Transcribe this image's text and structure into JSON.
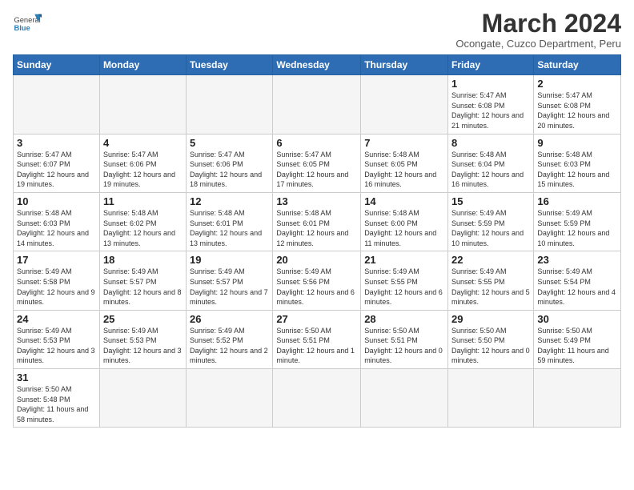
{
  "header": {
    "logo_general": "General",
    "logo_blue": "Blue",
    "month_title": "March 2024",
    "subtitle": "Ocongate, Cuzco Department, Peru"
  },
  "weekdays": [
    "Sunday",
    "Monday",
    "Tuesday",
    "Wednesday",
    "Thursday",
    "Friday",
    "Saturday"
  ],
  "weeks": [
    [
      {
        "day": "",
        "info": ""
      },
      {
        "day": "",
        "info": ""
      },
      {
        "day": "",
        "info": ""
      },
      {
        "day": "",
        "info": ""
      },
      {
        "day": "",
        "info": ""
      },
      {
        "day": "1",
        "info": "Sunrise: 5:47 AM\nSunset: 6:08 PM\nDaylight: 12 hours and 21 minutes."
      },
      {
        "day": "2",
        "info": "Sunrise: 5:47 AM\nSunset: 6:08 PM\nDaylight: 12 hours and 20 minutes."
      }
    ],
    [
      {
        "day": "3",
        "info": "Sunrise: 5:47 AM\nSunset: 6:07 PM\nDaylight: 12 hours and 19 minutes."
      },
      {
        "day": "4",
        "info": "Sunrise: 5:47 AM\nSunset: 6:06 PM\nDaylight: 12 hours and 19 minutes."
      },
      {
        "day": "5",
        "info": "Sunrise: 5:47 AM\nSunset: 6:06 PM\nDaylight: 12 hours and 18 minutes."
      },
      {
        "day": "6",
        "info": "Sunrise: 5:47 AM\nSunset: 6:05 PM\nDaylight: 12 hours and 17 minutes."
      },
      {
        "day": "7",
        "info": "Sunrise: 5:48 AM\nSunset: 6:05 PM\nDaylight: 12 hours and 16 minutes."
      },
      {
        "day": "8",
        "info": "Sunrise: 5:48 AM\nSunset: 6:04 PM\nDaylight: 12 hours and 16 minutes."
      },
      {
        "day": "9",
        "info": "Sunrise: 5:48 AM\nSunset: 6:03 PM\nDaylight: 12 hours and 15 minutes."
      }
    ],
    [
      {
        "day": "10",
        "info": "Sunrise: 5:48 AM\nSunset: 6:03 PM\nDaylight: 12 hours and 14 minutes."
      },
      {
        "day": "11",
        "info": "Sunrise: 5:48 AM\nSunset: 6:02 PM\nDaylight: 12 hours and 13 minutes."
      },
      {
        "day": "12",
        "info": "Sunrise: 5:48 AM\nSunset: 6:01 PM\nDaylight: 12 hours and 13 minutes."
      },
      {
        "day": "13",
        "info": "Sunrise: 5:48 AM\nSunset: 6:01 PM\nDaylight: 12 hours and 12 minutes."
      },
      {
        "day": "14",
        "info": "Sunrise: 5:48 AM\nSunset: 6:00 PM\nDaylight: 12 hours and 11 minutes."
      },
      {
        "day": "15",
        "info": "Sunrise: 5:49 AM\nSunset: 5:59 PM\nDaylight: 12 hours and 10 minutes."
      },
      {
        "day": "16",
        "info": "Sunrise: 5:49 AM\nSunset: 5:59 PM\nDaylight: 12 hours and 10 minutes."
      }
    ],
    [
      {
        "day": "17",
        "info": "Sunrise: 5:49 AM\nSunset: 5:58 PM\nDaylight: 12 hours and 9 minutes."
      },
      {
        "day": "18",
        "info": "Sunrise: 5:49 AM\nSunset: 5:57 PM\nDaylight: 12 hours and 8 minutes."
      },
      {
        "day": "19",
        "info": "Sunrise: 5:49 AM\nSunset: 5:57 PM\nDaylight: 12 hours and 7 minutes."
      },
      {
        "day": "20",
        "info": "Sunrise: 5:49 AM\nSunset: 5:56 PM\nDaylight: 12 hours and 6 minutes."
      },
      {
        "day": "21",
        "info": "Sunrise: 5:49 AM\nSunset: 5:55 PM\nDaylight: 12 hours and 6 minutes."
      },
      {
        "day": "22",
        "info": "Sunrise: 5:49 AM\nSunset: 5:55 PM\nDaylight: 12 hours and 5 minutes."
      },
      {
        "day": "23",
        "info": "Sunrise: 5:49 AM\nSunset: 5:54 PM\nDaylight: 12 hours and 4 minutes."
      }
    ],
    [
      {
        "day": "24",
        "info": "Sunrise: 5:49 AM\nSunset: 5:53 PM\nDaylight: 12 hours and 3 minutes."
      },
      {
        "day": "25",
        "info": "Sunrise: 5:49 AM\nSunset: 5:53 PM\nDaylight: 12 hours and 3 minutes."
      },
      {
        "day": "26",
        "info": "Sunrise: 5:49 AM\nSunset: 5:52 PM\nDaylight: 12 hours and 2 minutes."
      },
      {
        "day": "27",
        "info": "Sunrise: 5:50 AM\nSunset: 5:51 PM\nDaylight: 12 hours and 1 minute."
      },
      {
        "day": "28",
        "info": "Sunrise: 5:50 AM\nSunset: 5:51 PM\nDaylight: 12 hours and 0 minutes."
      },
      {
        "day": "29",
        "info": "Sunrise: 5:50 AM\nSunset: 5:50 PM\nDaylight: 12 hours and 0 minutes."
      },
      {
        "day": "30",
        "info": "Sunrise: 5:50 AM\nSunset: 5:49 PM\nDaylight: 11 hours and 59 minutes."
      }
    ],
    [
      {
        "day": "31",
        "info": "Sunrise: 5:50 AM\nSunset: 5:48 PM\nDaylight: 11 hours and 58 minutes."
      },
      {
        "day": "",
        "info": ""
      },
      {
        "day": "",
        "info": ""
      },
      {
        "day": "",
        "info": ""
      },
      {
        "day": "",
        "info": ""
      },
      {
        "day": "",
        "info": ""
      },
      {
        "day": "",
        "info": ""
      }
    ]
  ]
}
